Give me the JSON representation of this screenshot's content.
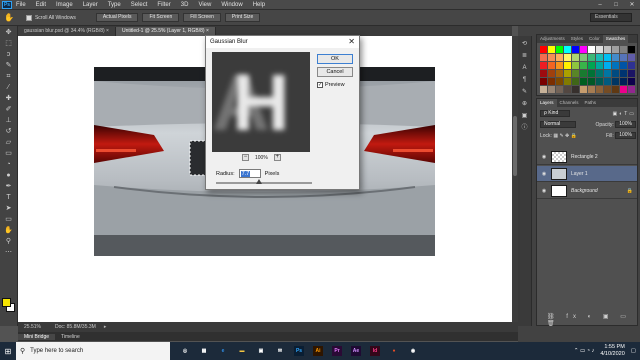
{
  "menubar": {
    "logo": "Ps",
    "items": [
      "File",
      "Edit",
      "Image",
      "Layer",
      "Type",
      "Select",
      "Filter",
      "3D",
      "View",
      "Window",
      "Help"
    ],
    "window_controls": [
      "–",
      "□",
      "✕"
    ]
  },
  "optionsbar": {
    "scroll_all_windows": "Scroll All Windows",
    "buttons": [
      "Actual Pixels",
      "Fit Screen",
      "Fill Screen",
      "Print Size"
    ],
    "workspace": "Essentials"
  },
  "tabs": [
    {
      "label": "gaussian blur.psd @ 34.4% (RGB/8) ×"
    },
    {
      "label": "Untitled-1 @ 25.5% (Layer 1, RGB/8) ×"
    }
  ],
  "status": {
    "zoom": "25.51%",
    "doc": "Doc: 85.8M/35.3M",
    "bottom_tabs": [
      "Mini Bridge",
      "Timeline"
    ]
  },
  "dialog": {
    "title": "Gaussian Blur",
    "close": "✕",
    "ok": "OK",
    "cancel": "Cancel",
    "preview_label": "Preview",
    "preview_checked": "✓",
    "preview_text": "H",
    "zoom_minus": "−",
    "zoom_plus": "+",
    "zoom_level": "100%",
    "radius_label": "Radius:",
    "radius_value": "7.7",
    "radius_unit": "Pixels",
    "radius_slider_fraction": 0.45
  },
  "panels": {
    "swatch_tabs": [
      "Adjustments",
      "Styles",
      "Color",
      "Swatches"
    ],
    "swatch_colors": [
      "#ff0000",
      "#ffff00",
      "#00ff00",
      "#00ffff",
      "#0000ff",
      "#ff00ff",
      "#ffffff",
      "#e0e0e0",
      "#c0c0c0",
      "#a0a0a0",
      "#808080",
      "#000000",
      "#f26c4f",
      "#f68e56",
      "#fbaf5c",
      "#fff467",
      "#acd372",
      "#7cc576",
      "#3bb878",
      "#1abbb4",
      "#00bff3",
      "#438cca",
      "#5674b9",
      "#605ca8",
      "#ed1c24",
      "#f26522",
      "#f7941d",
      "#fff200",
      "#8dc63f",
      "#39b54a",
      "#00a651",
      "#00a99d",
      "#00aeef",
      "#0072bc",
      "#0054a6",
      "#2e3192",
      "#9e0b0f",
      "#a0410d",
      "#a3620a",
      "#aba000",
      "#598527",
      "#197b30",
      "#007236",
      "#00746b",
      "#0076a3",
      "#004b80",
      "#003471",
      "#1b1464",
      "#790000",
      "#7b2e00",
      "#7d4900",
      "#827b00",
      "#406618",
      "#005e20",
      "#005826",
      "#005952",
      "#005b7f",
      "#003663",
      "#002157",
      "#0d004c",
      "#c7b299",
      "#998675",
      "#736357",
      "#534741",
      "#37302d",
      "#c69c6d",
      "#a67c52",
      "#8c6239",
      "#754c24",
      "#603913",
      "#ec008c",
      "#92278f"
    ],
    "layers_tabs": [
      "Layers",
      "Channels",
      "Paths"
    ],
    "kind_label": "ρ Kind",
    "blend_mode": "Normal",
    "opacity_label": "Opacity:",
    "opacity_value": "100%",
    "lock_label": "Lock:",
    "fill_label": "Fill:",
    "fill_value": "100%",
    "layers": [
      {
        "name": "Rectangle 2",
        "visible": "◉"
      },
      {
        "name": "Layer 1",
        "visible": "◉"
      },
      {
        "name": "Background",
        "visible": "◉"
      }
    ]
  },
  "taskbar": {
    "start": "⊞",
    "search_placeholder": "Type here to search",
    "apps": [
      {
        "label": "◎",
        "color": "#ffffff",
        "bg": "transparent"
      },
      {
        "label": "▦",
        "color": "#ffffff",
        "bg": "transparent"
      },
      {
        "label": "e",
        "color": "#2f8fe8",
        "bg": "transparent"
      },
      {
        "label": "▬",
        "color": "#f4c542",
        "bg": "transparent"
      },
      {
        "label": "▣",
        "color": "#ffffff",
        "bg": "transparent"
      },
      {
        "label": "✉",
        "color": "#ffffff",
        "bg": "transparent"
      },
      {
        "label": "Ps",
        "color": "#31a8ff",
        "bg": "#0a1e33"
      },
      {
        "label": "Ai",
        "color": "#ff9a00",
        "bg": "#2e1500"
      },
      {
        "label": "Pr",
        "color": "#e77cff",
        "bg": "#2a0a35"
      },
      {
        "label": "Ae",
        "color": "#d291ff",
        "bg": "#1f0a33"
      },
      {
        "label": "Id",
        "color": "#ff3d8b",
        "bg": "#33071a"
      },
      {
        "label": "●",
        "color": "#e44d26",
        "bg": "transparent"
      },
      {
        "label": "◉",
        "color": "#ffffff",
        "bg": "transparent"
      }
    ],
    "time": "1:55 PM",
    "date": "4/10/2020"
  }
}
